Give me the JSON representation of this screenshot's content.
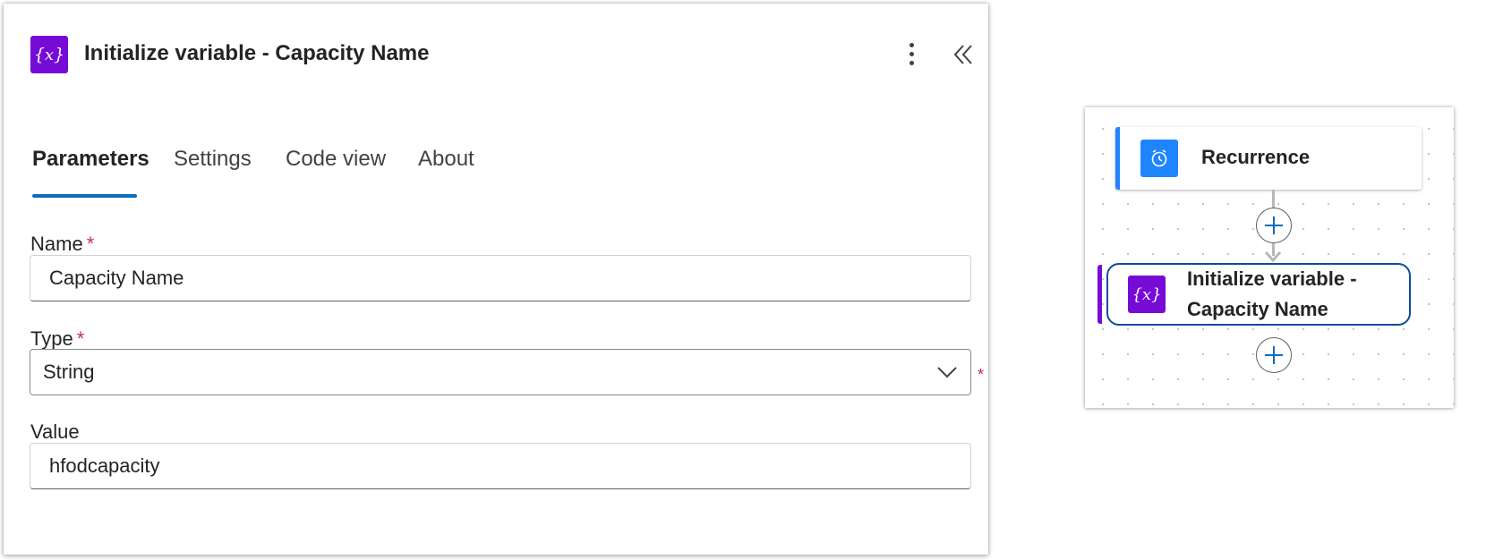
{
  "panel": {
    "title": "Initialize variable - Capacity Name",
    "icon": "variable-icon",
    "icon_color": "#770bd6",
    "tabs": [
      {
        "label": "Parameters",
        "active": true
      },
      {
        "label": "Settings",
        "active": false
      },
      {
        "label": "Code view",
        "active": false
      },
      {
        "label": "About",
        "active": false
      }
    ],
    "fields": {
      "name": {
        "label": "Name",
        "required_mark": "*",
        "value": "Capacity Name"
      },
      "type": {
        "label": "Type",
        "required_mark": "*",
        "value": "String",
        "outer_required_mark": "*"
      },
      "value": {
        "label": "Value",
        "value": "hfodcapacity"
      }
    }
  },
  "flow": {
    "nodes": [
      {
        "label": "Recurrence",
        "icon": "alarm-clock-icon",
        "color": "#1f85ff"
      },
      {
        "label_line1": "Initialize variable -",
        "label_line2": "Capacity Name",
        "icon": "variable-icon",
        "color": "#770bd6",
        "selected": true
      }
    ]
  },
  "colors": {
    "accent": "#0f6cbd",
    "required": "#c4314b"
  }
}
